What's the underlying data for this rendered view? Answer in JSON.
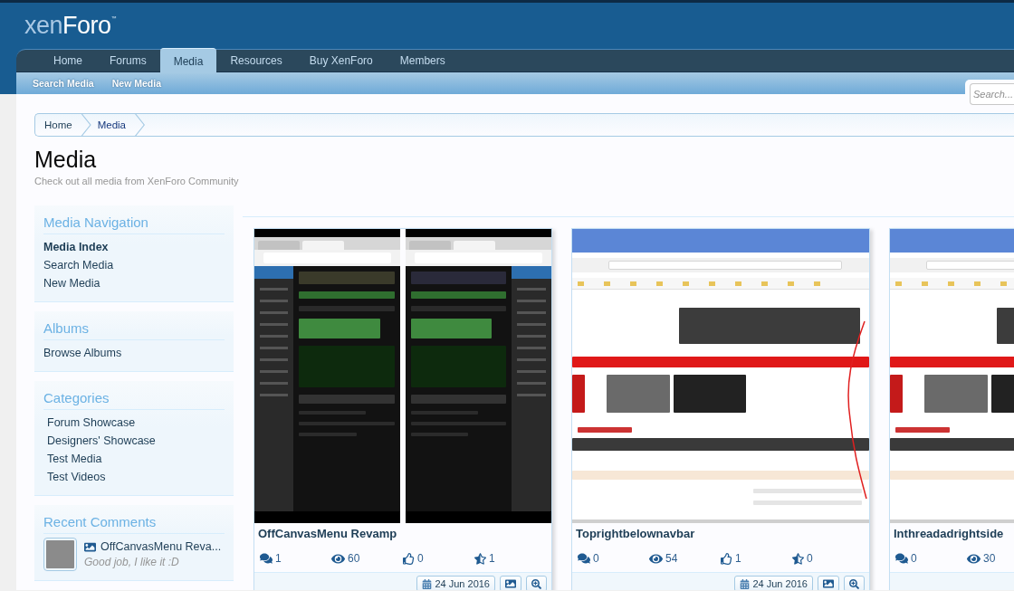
{
  "header": {
    "logo": [
      {
        "kind": "light",
        "text": "xen"
      },
      {
        "kind": "bright",
        "text": "Foro"
      },
      {
        "kind": "mark",
        "text": "™"
      }
    ],
    "tabs": [
      {
        "label": "Home",
        "selected": false
      },
      {
        "label": "Forums",
        "selected": false
      },
      {
        "label": "Media",
        "selected": true
      },
      {
        "label": "Resources",
        "selected": false
      },
      {
        "label": "Buy XenForo",
        "selected": false
      },
      {
        "label": "Members",
        "selected": false
      }
    ],
    "subnav": [
      "Search Media",
      "New Media"
    ],
    "search": {
      "placeholder": "Search..."
    }
  },
  "breadcrumb": [
    "Home",
    "Media"
  ],
  "page": {
    "title": "Media",
    "description": "Check out all media from XenForo Community"
  },
  "sidebar": [
    {
      "kind": "links",
      "heading": "Media Navigation",
      "items": [
        {
          "label": "Media Index",
          "selected": true
        },
        {
          "label": "Search Media",
          "selected": false
        },
        {
          "label": "New Media",
          "selected": false
        }
      ]
    },
    {
      "kind": "links",
      "heading": "Albums",
      "items": [
        {
          "label": "Browse Albums",
          "selected": false
        }
      ]
    },
    {
      "kind": "categories",
      "heading": "Categories",
      "items": [
        "Forum Showcase",
        "Designers' Showcase",
        "Test Media",
        "Test Videos"
      ]
    },
    {
      "kind": "comments",
      "heading": "Recent Comments",
      "comments": [
        {
          "media": "OffCanvasMenu Reva...",
          "text": "Good job, I like it :D"
        }
      ]
    }
  ],
  "media": [
    {
      "kind": "phone-pair",
      "title": "OffCanvasMenu Revamp",
      "stats": [
        {
          "kind": "comments",
          "value": "1"
        },
        {
          "kind": "views",
          "value": "60"
        },
        {
          "kind": "likes",
          "value": "0"
        },
        {
          "kind": "rating",
          "value": "1"
        }
      ],
      "date": "24 Jun 2016"
    },
    {
      "kind": "browser",
      "title": "Toprightbelownavbar",
      "stats": [
        {
          "kind": "comments",
          "value": "0"
        },
        {
          "kind": "views",
          "value": "54"
        },
        {
          "kind": "likes",
          "value": "1"
        },
        {
          "kind": "rating",
          "value": "0"
        }
      ],
      "date": "24 Jun 2016"
    },
    {
      "kind": "browser",
      "title": "Inthreadadrightside",
      "stats": [
        {
          "kind": "comments",
          "value": "0"
        },
        {
          "kind": "views",
          "value": "30"
        }
      ]
    }
  ]
}
